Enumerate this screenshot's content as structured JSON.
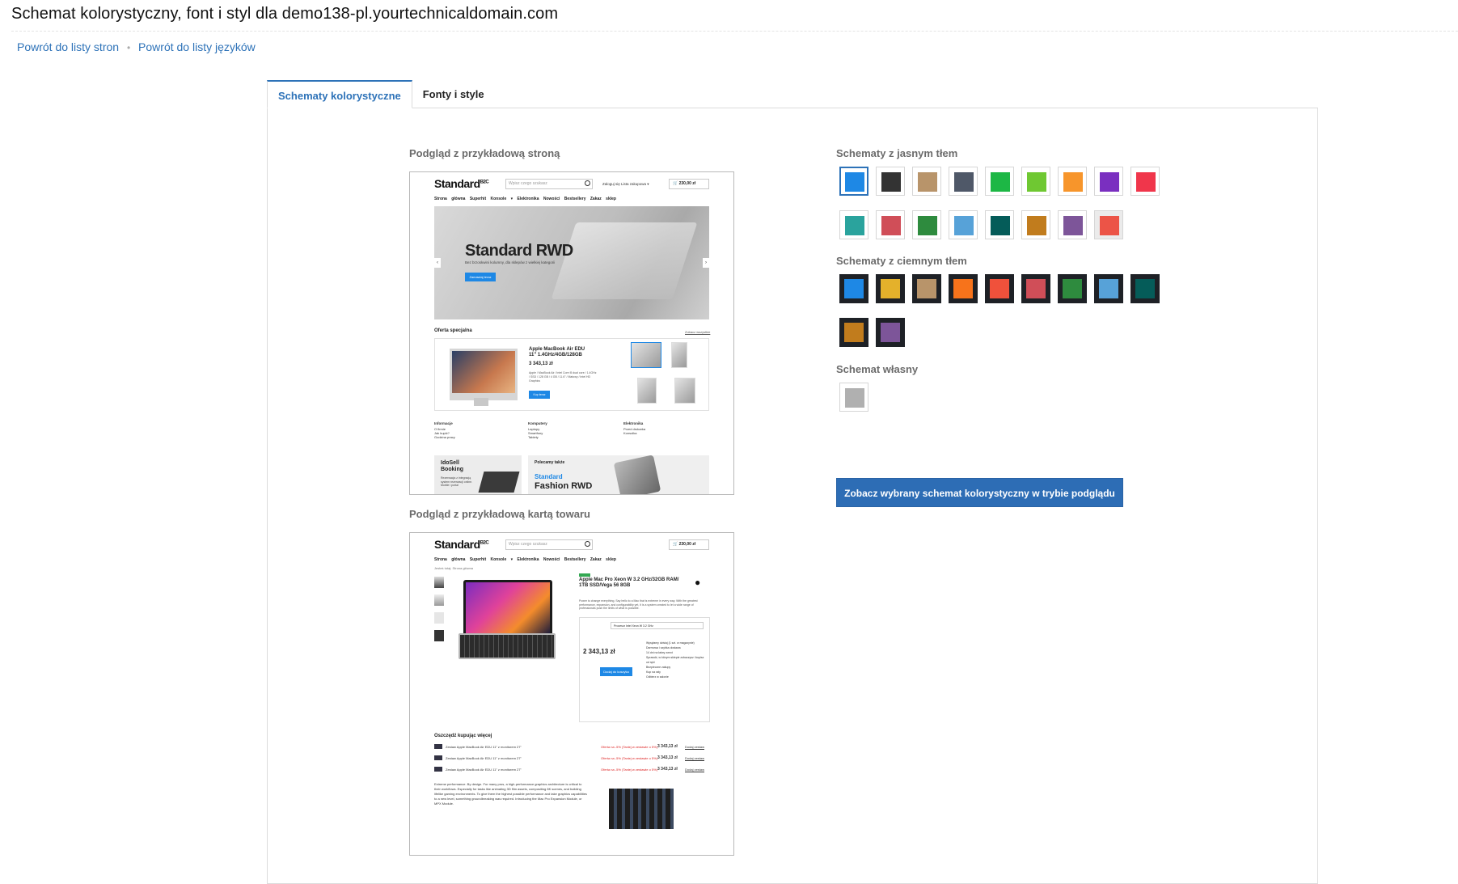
{
  "page": {
    "title": "Schemat kolorystyczny, font i styl dla demo138-pl.yourtechnicaldomain.com"
  },
  "breadcrumb": {
    "back_pages": "Powrót do listy stron",
    "separator": "•",
    "back_languages": "Powrót do listy języków"
  },
  "tabs": [
    {
      "label": "Schematy kolorystyczne",
      "active": true
    },
    {
      "label": "Fonty i style",
      "active": false
    }
  ],
  "preview_page": {
    "label": "Podgląd z przykładową stroną",
    "logo": "Standard",
    "logo_sup": "B2C",
    "search_placeholder": "Wpisz czego szukasz",
    "top_menu": "Zaloguj się     Lista zakupowa ▾",
    "basket": "230,00 zł",
    "nav": "Strona główna  Superhit  Konsole ▾  Elektronika  Nowości  Bestsellery  Zakaz sklep",
    "hero_title": "Standard RWD",
    "hero_subtitle": "Bez brzoskwini kolumny, dla sklepów z wielkiej kategorii",
    "hero_button": "Zamawiaj teraz",
    "special_offer": "Oferta specjalna",
    "special_offer_link": "Zobacz wszystkie",
    "offer_title": "Apple MacBook Air EDU\n11\" 1.4GHz/4GB/128GB",
    "offer_price": "3 343,13 zł",
    "offer_desc": "Apple / MacBook Air / Intel Core i5 dual core / 1.4GHz / SSD / 128 GB / 4 GB / 11.6\" / Matowy / Intel HD Graphics",
    "offer_button": "Kup teraz",
    "footer_cols": [
      {
        "title": "Informacje",
        "items": [
          "O firmie",
          "Jak kupić?",
          "Godzina pracy"
        ]
      },
      {
        "title": "Komputery",
        "items": [
          "Laptopy",
          "Smartfony",
          "Tablety"
        ]
      },
      {
        "title": "Elektronika",
        "items": [
          "Przed drukarka",
          "Konsolka"
        ]
      }
    ],
    "banner1_title": "IdoSell Booking",
    "banner1_text": "Rezerwacja z integracją system rezerwacji online. Mobile i portal",
    "banner2_top": "Polecamy także",
    "banner2_title": "Standard",
    "banner2_sub": "Fashion RWD"
  },
  "preview_product": {
    "label": "Podgląd z przykładową kartą towaru",
    "logo": "Standard",
    "logo_sup": "B2C",
    "search_placeholder": "Wpisz czego szukasz",
    "basket": "230,00 zł",
    "nav": "Strona główna  Superhit  Konsole ▾  Elektronika  Nowości  Bestsellery  Zakaz sklep",
    "breadcrumb": "Jesteś tutaj:  Strona główna",
    "badge": "",
    "title": "Apple Mac Pro Xeon W 3.2 GHz/32GB RAM/\n1TB SSD/Vega 56 8GB",
    "desc": "Power to change everything. Say hello to a Mac that is extreme in every way. With the greatest performance, expansion, and configurability yet, it is a system created to let a wide range of professionals push the limits of what is possible.",
    "select": "Procesor Intel Xeon W 3.2 GHz",
    "price": "2 343,13 zł",
    "cart_button": "Dodaj do koszyka",
    "right_info": "Wysyłamy dzisiaj (1 szt. w magazynie)\nDarmowa i szybka dostawa\n14 dni na łatwy zwrot\nSprawdź, w którym sklepie zobaczysz i kupisz od ręki\nBezpieczne zakupy\nKup na raty\nOdbierz w salonie",
    "bundle_title": "Oszczędź kupując więcej",
    "bundles": [
      {
        "text": "Zestaw Apple MacBook Air EDU 11\" z monitorem 27\"",
        "promo": "Oferta na -5% (Taniej w zestawie o 5%)",
        "price": "3 343,13 zł",
        "link": "Dodaj zestaw"
      },
      {
        "text": "Zestaw Apple MacBook Air EDU 11\" z monitorem 27\"",
        "promo": "Oferta na -5% (Taniej w zestawie o 5%)",
        "price": "3 343,13 zł",
        "link": "Dodaj zestaw"
      },
      {
        "text": "Zestaw Apple MacBook Air EDU 11\" z monitorem 27\"",
        "promo": "Oferta na -5% (Taniej w zestawie o 5%)",
        "price": "3 343,13 zł",
        "link": "Dodaj zestaw"
      }
    ],
    "text": "Extreme performance. By design. For many pros, a high-performance graphics architecture is critical to their workflows. Especially for tasks like animating 3D film assets, compositing 8K scenes, and building lifelike gaming environments. To give them the highest possible performance and take graphics capabilities to a new level, something groundbreaking was required. Introducing the Mac Pro Expansion Module, or MPX Module."
  },
  "schemes": {
    "light_label": "Schematy z jasnym tłem",
    "light": [
      {
        "color": "#1e88e5",
        "selected": true
      },
      {
        "color": "#333333"
      },
      {
        "color": "#b8946a"
      },
      {
        "color": "#4f5868"
      },
      {
        "color": "#1db745"
      },
      {
        "color": "#6fc832"
      },
      {
        "color": "#f7952b"
      },
      {
        "color": "#7a2fc0"
      },
      {
        "color": "#f0364b"
      },
      {
        "color": "#2aa39d"
      },
      {
        "color": "#d04e58"
      },
      {
        "color": "#2e8b3e"
      },
      {
        "color": "#57a2d8"
      },
      {
        "color": "#055c59"
      },
      {
        "color": "#c17c1d"
      },
      {
        "color": "#7d5599"
      },
      {
        "color": "#ec5447",
        "hover": true
      }
    ],
    "dark_label": "Schematy z ciemnym tłem",
    "dark": [
      {
        "color": "#1e88e5"
      },
      {
        "color": "#e4b12b"
      },
      {
        "color": "#b8946a"
      },
      {
        "color": "#f7731b"
      },
      {
        "color": "#f0513b"
      },
      {
        "color": "#d04e58"
      },
      {
        "color": "#2e8b3e"
      },
      {
        "color": "#57a2d8"
      },
      {
        "color": "#055c59"
      },
      {
        "color": "#c17c1d"
      },
      {
        "color": "#7d5599"
      }
    ],
    "custom_label": "Schemat własny",
    "custom": {
      "color": "#b0b0b0"
    }
  },
  "actions": {
    "preview_button": "Zobacz wybrany schemat kolorystyczny w trybie podglądu"
  },
  "colors": {
    "accent": "#2d72b8",
    "button": "#2d6db5"
  }
}
